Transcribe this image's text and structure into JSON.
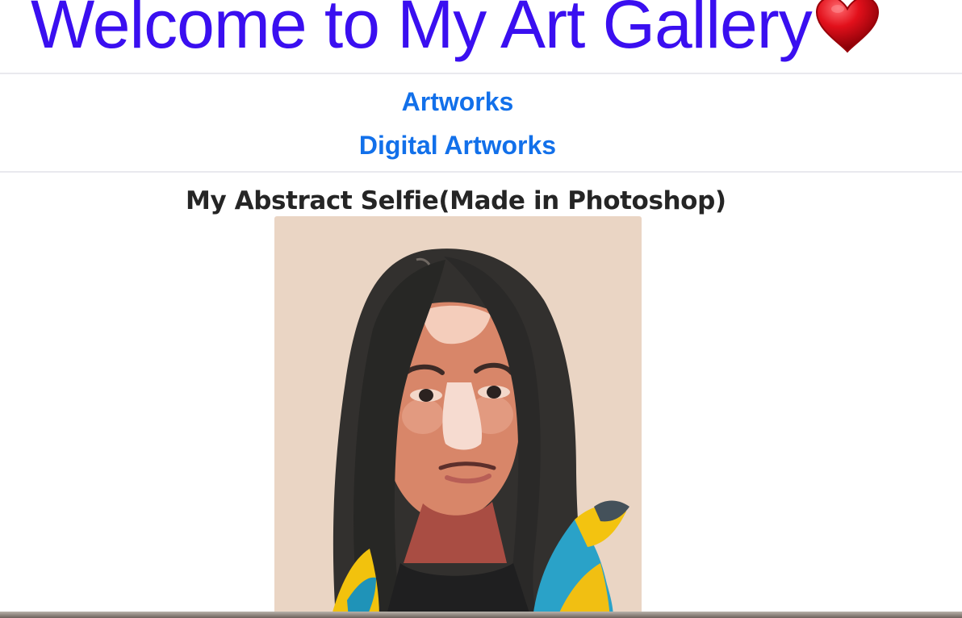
{
  "header": {
    "title": "Welcome to My Art Gallery",
    "title_color": "#3a0ff0",
    "heart_icon": "heart-icon",
    "heart_color": "#e2101b"
  },
  "nav": {
    "link_color": "#1270ea",
    "links": [
      {
        "label": "Artworks"
      },
      {
        "label": "Digital Artworks"
      }
    ]
  },
  "artwork": {
    "title": "My Abstract Selfie(Made in Photoshop)",
    "title_color": "#252525",
    "background_color": "#ead5c4"
  }
}
